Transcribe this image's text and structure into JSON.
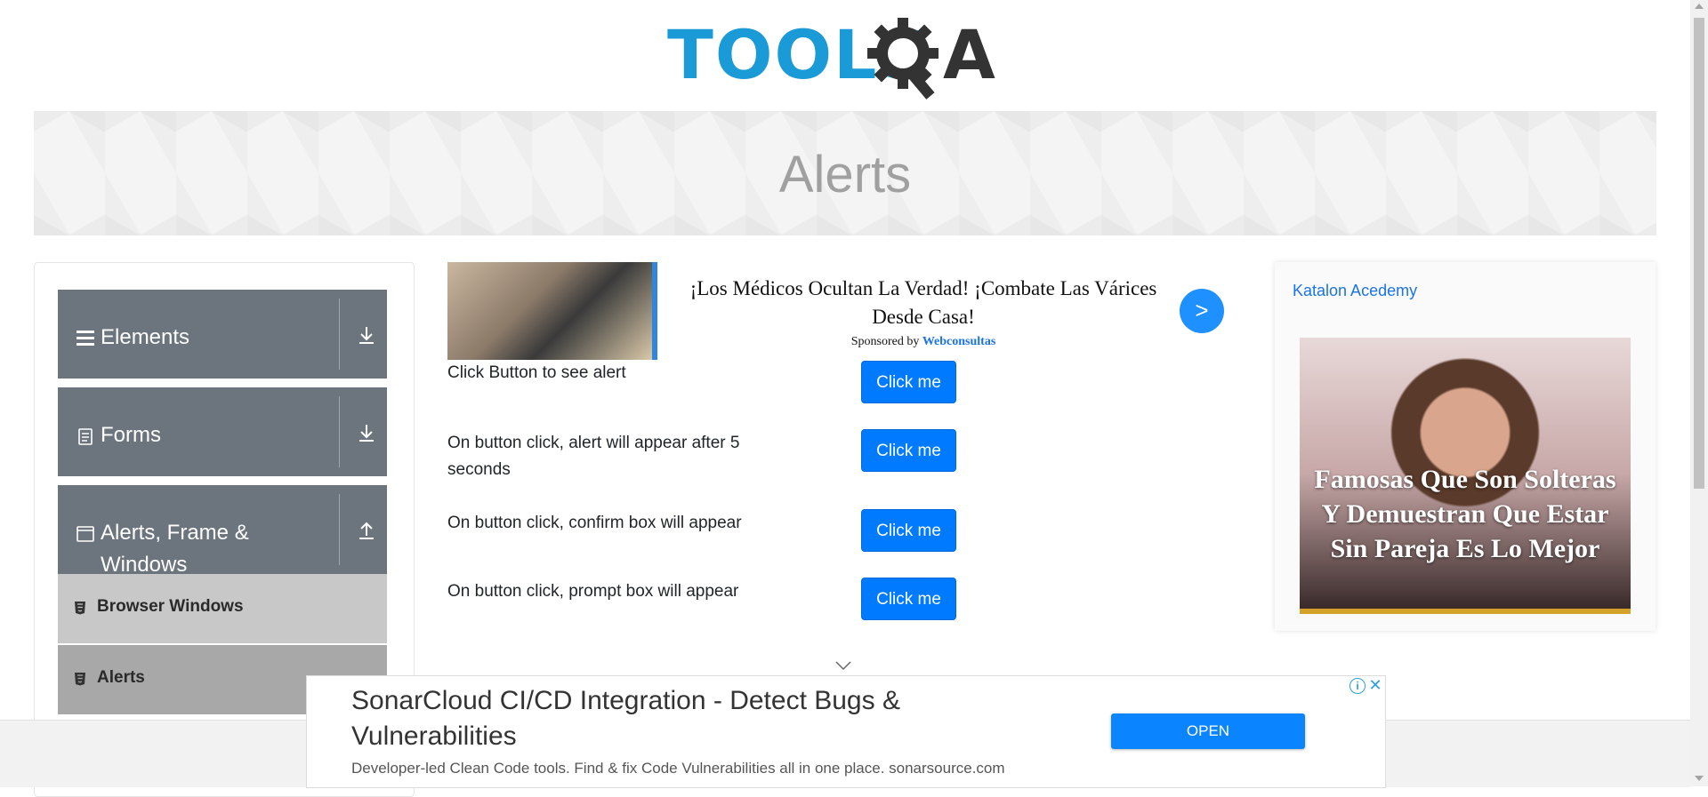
{
  "header": {
    "logo_text_left": "TOOLS",
    "logo_text_right": "A",
    "logo_alt": "ToolsQA"
  },
  "banner": {
    "title": "Alerts"
  },
  "sidebar": {
    "groups": [
      {
        "label": "Elements",
        "icon": "hamburger-icon",
        "expanded": false
      },
      {
        "label": "Forms",
        "icon": "document-icon",
        "expanded": false
      },
      {
        "label": "Alerts, Frame &",
        "label_line2": "Windows",
        "icon": "window-icon",
        "expanded": true
      }
    ],
    "items": [
      {
        "label": "Browser Windows",
        "icon": "html5-icon",
        "active": false
      },
      {
        "label": "Alerts",
        "icon": "html5-icon",
        "active": true
      }
    ]
  },
  "ad_top": {
    "headline": "¡Los Médicos Ocultan La Verdad! ¡Combate Las Várices Desde Casa!",
    "sponsored_prefix": "Sponsored by",
    "sponsor": "Webconsultas",
    "next_label": ">"
  },
  "alerts": [
    {
      "label": "Click Button to see alert",
      "button": "Click me"
    },
    {
      "label": "On button click, alert will appear after 5 seconds",
      "button": "Click me"
    },
    {
      "label": "On button click, confirm box will appear",
      "button": "Click me"
    },
    {
      "label": "On button click, prompt box will appear",
      "button": "Click me"
    }
  ],
  "right_ad": {
    "broken_image_alt": "Katalon Acedemy",
    "caption": "Famosas Que Son Solteras Y Demuestran Que Estar Sin Pareja Es Lo Mejor"
  },
  "bottom_ad": {
    "title": "SonarCloud CI/CD Integration - Detect Bugs & Vulnerabilities",
    "description": "Developer-led Clean Code tools. Find & fix Code Vulnerabilities all in one place. sonarsource.com",
    "open_label": "OPEN",
    "info_glyph": "i",
    "close_glyph": "✕"
  },
  "colors": {
    "nav_group_bg": "#6c757d",
    "nav_item_bg": "#c8c8c8",
    "nav_item_active_bg": "#a8a8a8",
    "primary": "#007bff",
    "logo_blue": "#1a9ad6"
  }
}
